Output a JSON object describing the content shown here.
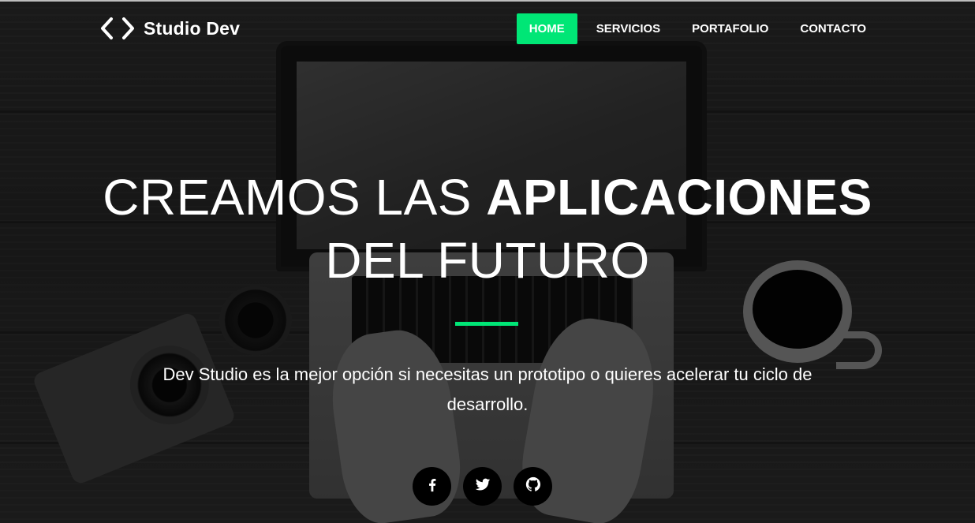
{
  "brand": {
    "name": "Studio Dev",
    "icon": "code-brackets-icon"
  },
  "nav": {
    "items": [
      {
        "label": "HOME",
        "active": true
      },
      {
        "label": "SERVICIOS",
        "active": false
      },
      {
        "label": "PORTAFOLIO",
        "active": false
      },
      {
        "label": "CONTACTO",
        "active": false
      }
    ]
  },
  "hero": {
    "headline_light": "CREAMOS LAS ",
    "headline_bold": "APLICACIONES",
    "headline_line2": "DEL FUTURO",
    "tagline": "Dev Studio es la mejor opción si necesitas un prototipo o quieres acelerar tu ciclo de desarrollo."
  },
  "social": [
    {
      "icon": "facebook-icon"
    },
    {
      "icon": "twitter-icon"
    },
    {
      "icon": "github-icon"
    }
  ],
  "colors": {
    "accent": "#00e676",
    "overlay": "#000000",
    "text": "#ffffff"
  }
}
